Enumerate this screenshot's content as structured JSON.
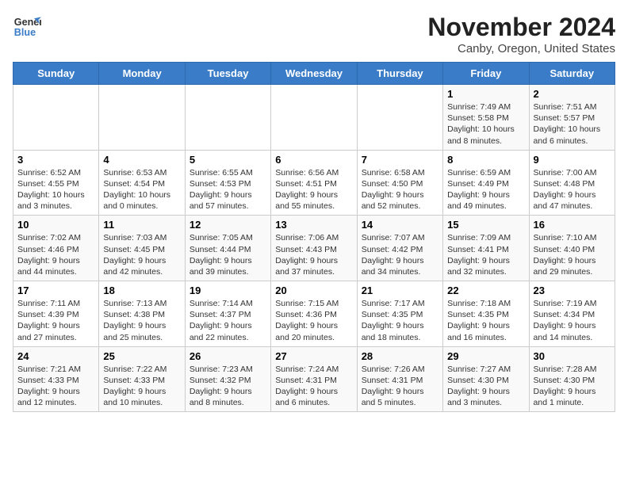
{
  "logo": {
    "line1": "General",
    "line2": "Blue"
  },
  "title": "November 2024",
  "location": "Canby, Oregon, United States",
  "days_of_week": [
    "Sunday",
    "Monday",
    "Tuesday",
    "Wednesday",
    "Thursday",
    "Friday",
    "Saturday"
  ],
  "weeks": [
    [
      {
        "day": "",
        "info": ""
      },
      {
        "day": "",
        "info": ""
      },
      {
        "day": "",
        "info": ""
      },
      {
        "day": "",
        "info": ""
      },
      {
        "day": "",
        "info": ""
      },
      {
        "day": "1",
        "info": "Sunrise: 7:49 AM\nSunset: 5:58 PM\nDaylight: 10 hours\nand 8 minutes."
      },
      {
        "day": "2",
        "info": "Sunrise: 7:51 AM\nSunset: 5:57 PM\nDaylight: 10 hours\nand 6 minutes."
      }
    ],
    [
      {
        "day": "3",
        "info": "Sunrise: 6:52 AM\nSunset: 4:55 PM\nDaylight: 10 hours\nand 3 minutes."
      },
      {
        "day": "4",
        "info": "Sunrise: 6:53 AM\nSunset: 4:54 PM\nDaylight: 10 hours\nand 0 minutes."
      },
      {
        "day": "5",
        "info": "Sunrise: 6:55 AM\nSunset: 4:53 PM\nDaylight: 9 hours\nand 57 minutes."
      },
      {
        "day": "6",
        "info": "Sunrise: 6:56 AM\nSunset: 4:51 PM\nDaylight: 9 hours\nand 55 minutes."
      },
      {
        "day": "7",
        "info": "Sunrise: 6:58 AM\nSunset: 4:50 PM\nDaylight: 9 hours\nand 52 minutes."
      },
      {
        "day": "8",
        "info": "Sunrise: 6:59 AM\nSunset: 4:49 PM\nDaylight: 9 hours\nand 49 minutes."
      },
      {
        "day": "9",
        "info": "Sunrise: 7:00 AM\nSunset: 4:48 PM\nDaylight: 9 hours\nand 47 minutes."
      }
    ],
    [
      {
        "day": "10",
        "info": "Sunrise: 7:02 AM\nSunset: 4:46 PM\nDaylight: 9 hours\nand 44 minutes."
      },
      {
        "day": "11",
        "info": "Sunrise: 7:03 AM\nSunset: 4:45 PM\nDaylight: 9 hours\nand 42 minutes."
      },
      {
        "day": "12",
        "info": "Sunrise: 7:05 AM\nSunset: 4:44 PM\nDaylight: 9 hours\nand 39 minutes."
      },
      {
        "day": "13",
        "info": "Sunrise: 7:06 AM\nSunset: 4:43 PM\nDaylight: 9 hours\nand 37 minutes."
      },
      {
        "day": "14",
        "info": "Sunrise: 7:07 AM\nSunset: 4:42 PM\nDaylight: 9 hours\nand 34 minutes."
      },
      {
        "day": "15",
        "info": "Sunrise: 7:09 AM\nSunset: 4:41 PM\nDaylight: 9 hours\nand 32 minutes."
      },
      {
        "day": "16",
        "info": "Sunrise: 7:10 AM\nSunset: 4:40 PM\nDaylight: 9 hours\nand 29 minutes."
      }
    ],
    [
      {
        "day": "17",
        "info": "Sunrise: 7:11 AM\nSunset: 4:39 PM\nDaylight: 9 hours\nand 27 minutes."
      },
      {
        "day": "18",
        "info": "Sunrise: 7:13 AM\nSunset: 4:38 PM\nDaylight: 9 hours\nand 25 minutes."
      },
      {
        "day": "19",
        "info": "Sunrise: 7:14 AM\nSunset: 4:37 PM\nDaylight: 9 hours\nand 22 minutes."
      },
      {
        "day": "20",
        "info": "Sunrise: 7:15 AM\nSunset: 4:36 PM\nDaylight: 9 hours\nand 20 minutes."
      },
      {
        "day": "21",
        "info": "Sunrise: 7:17 AM\nSunset: 4:35 PM\nDaylight: 9 hours\nand 18 minutes."
      },
      {
        "day": "22",
        "info": "Sunrise: 7:18 AM\nSunset: 4:35 PM\nDaylight: 9 hours\nand 16 minutes."
      },
      {
        "day": "23",
        "info": "Sunrise: 7:19 AM\nSunset: 4:34 PM\nDaylight: 9 hours\nand 14 minutes."
      }
    ],
    [
      {
        "day": "24",
        "info": "Sunrise: 7:21 AM\nSunset: 4:33 PM\nDaylight: 9 hours\nand 12 minutes."
      },
      {
        "day": "25",
        "info": "Sunrise: 7:22 AM\nSunset: 4:33 PM\nDaylight: 9 hours\nand 10 minutes."
      },
      {
        "day": "26",
        "info": "Sunrise: 7:23 AM\nSunset: 4:32 PM\nDaylight: 9 hours\nand 8 minutes."
      },
      {
        "day": "27",
        "info": "Sunrise: 7:24 AM\nSunset: 4:31 PM\nDaylight: 9 hours\nand 6 minutes."
      },
      {
        "day": "28",
        "info": "Sunrise: 7:26 AM\nSunset: 4:31 PM\nDaylight: 9 hours\nand 5 minutes."
      },
      {
        "day": "29",
        "info": "Sunrise: 7:27 AM\nSunset: 4:30 PM\nDaylight: 9 hours\nand 3 minutes."
      },
      {
        "day": "30",
        "info": "Sunrise: 7:28 AM\nSunset: 4:30 PM\nDaylight: 9 hours\nand 1 minute."
      }
    ]
  ]
}
